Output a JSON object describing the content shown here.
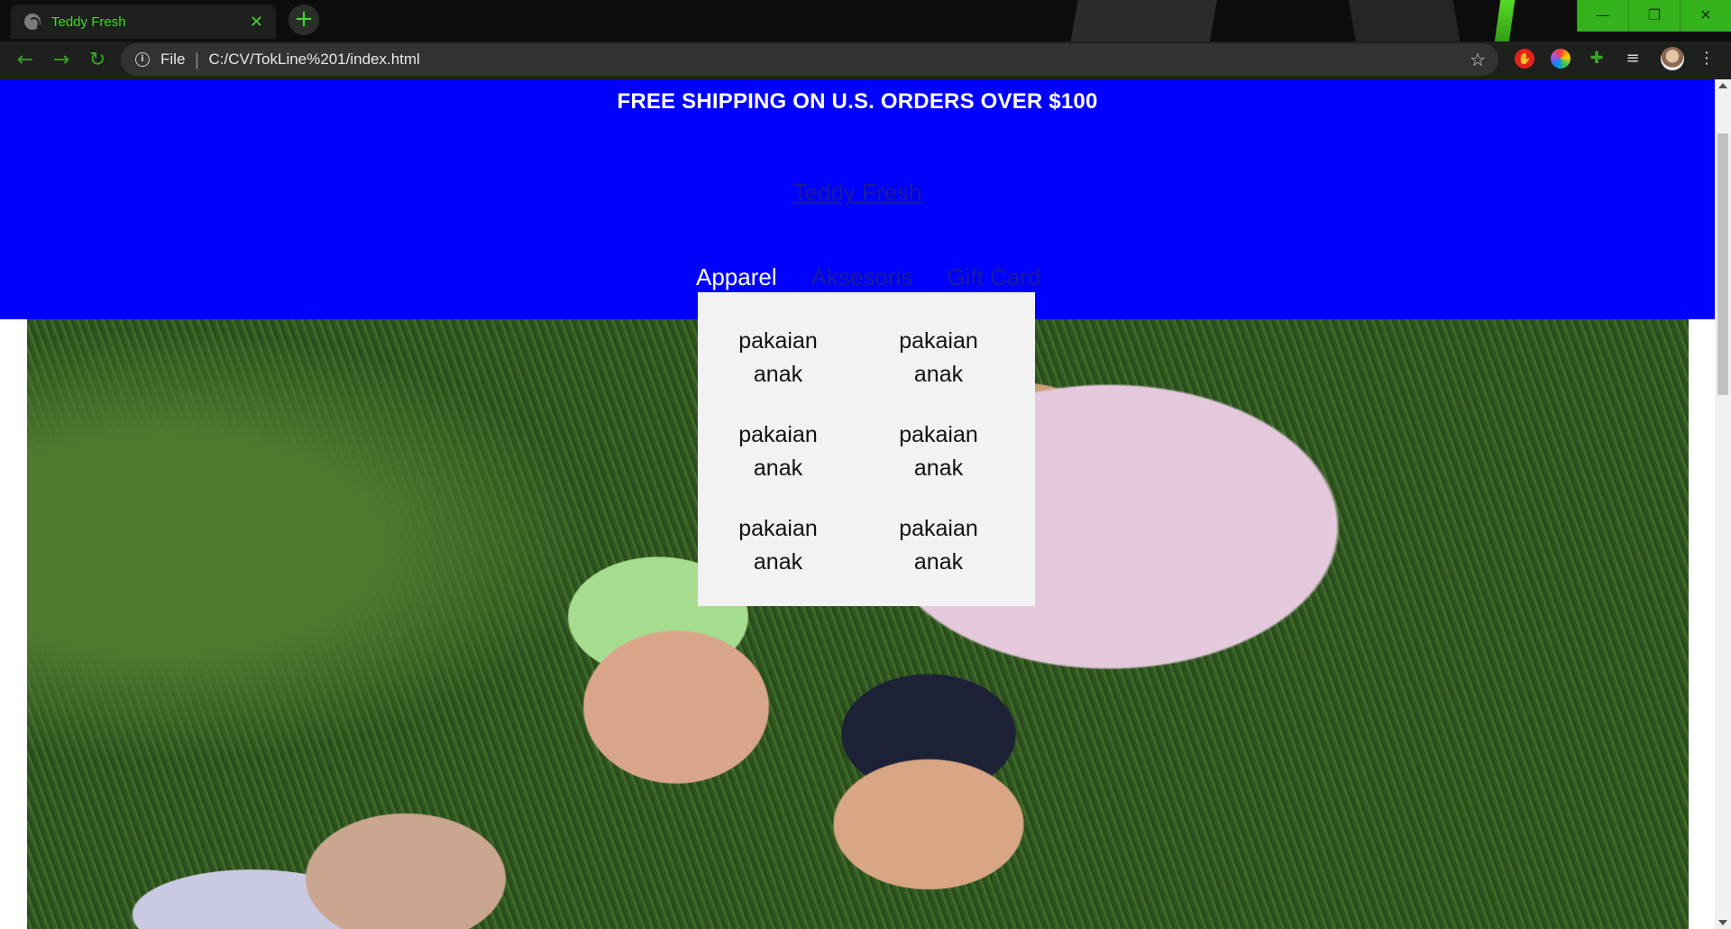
{
  "browser": {
    "tab_title": "Teddy Fresh",
    "tab_close": "✕",
    "new_tab": "+",
    "url_scheme": "File",
    "url_separator": "|",
    "url": "C:/CV/TokLine%201/index.html",
    "window_controls": [
      "—",
      "❐",
      "✕"
    ],
    "accent_color": "#43d62b"
  },
  "page": {
    "announcement": "FREE SHIPPING ON U.S. ORDERS OVER $100",
    "logo": "Teddy Fresh",
    "header_color": "#0000ff",
    "nav": [
      {
        "label": "Apparel"
      },
      {
        "label": "Aksesoris"
      },
      {
        "label": "Gift Card"
      }
    ],
    "dropdown": [
      "pakaian anak",
      "pakaian anak",
      "pakaian anak",
      "pakaian anak",
      "pakaian anak",
      "pakaian anak"
    ],
    "hero_image": "group of four people lying on grass"
  }
}
